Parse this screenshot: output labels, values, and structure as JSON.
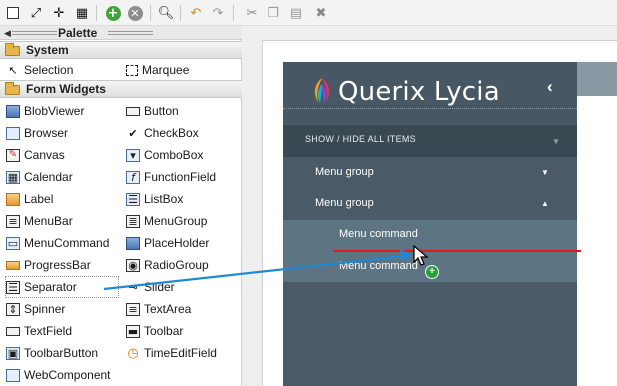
{
  "palette": {
    "title": "Palette",
    "sections": {
      "system": "System",
      "form_widgets": "Form Widgets"
    },
    "system_items": [
      "Selection",
      "Marquee"
    ],
    "widgets": [
      "BlobViewer",
      "Button",
      "Browser",
      "CheckBox",
      "Canvas",
      "ComboBox",
      "Calendar",
      "FunctionField",
      "Label",
      "ListBox",
      "MenuBar",
      "MenuGroup",
      "MenuCommand",
      "PlaceHolder",
      "ProgressBar",
      "RadioGroup",
      "Separator",
      "Slider",
      "Spinner",
      "TextArea",
      "TextField",
      "Toolbar",
      "ToolbarButton",
      "TimeEditField",
      "WebComponent"
    ]
  },
  "preview": {
    "brand": "Querix Lycia",
    "show_hide": "SHOW / HIDE ALL ITEMS",
    "menu_groups": [
      "Menu group",
      "Menu group"
    ],
    "menu_commands": [
      "Menu command",
      "Menu command"
    ]
  },
  "colors": {
    "sidebar": "#4a5b67",
    "drop_indicator": "#e3181f",
    "drag_arrow": "#1f8ad4",
    "add_badge": "#23a238"
  }
}
